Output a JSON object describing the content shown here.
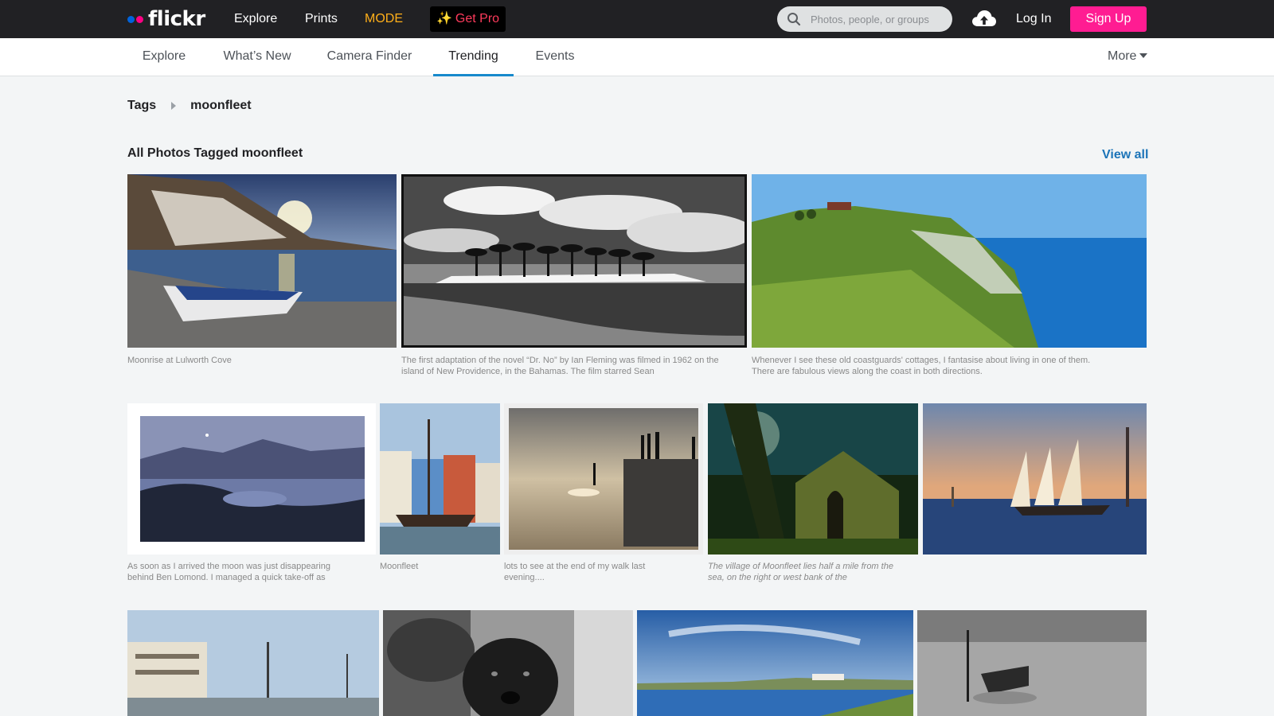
{
  "topbar": {
    "logo_text": "flickr",
    "nav": {
      "explore": "Explore",
      "prints": "Prints",
      "mode": "MODE"
    },
    "get_pro": "Get Pro",
    "search_placeholder": "Photos, people, or groups",
    "login": "Log In",
    "signup": "Sign Up"
  },
  "subnav": {
    "items": [
      "Explore",
      "What’s New",
      "Camera Finder",
      "Trending",
      "Events"
    ],
    "active": "Trending",
    "more": "More"
  },
  "breadcrumb": {
    "root": "Tags",
    "current": "moonfleet"
  },
  "section": {
    "title": "All Photos Tagged moonfleet",
    "view_all": "View all"
  },
  "photos": [
    {
      "caption": "Moonrise at Lulworth Cove"
    },
    {
      "caption": "The first adaptation of the novel “Dr. No” by Ian Fleming was filmed in 1962 on the island of New Providence, in the Bahamas. The film starred Sean"
    },
    {
      "caption": "Whenever I see these old coastguards' cottages, I fantasise about living in one of them. There are fabulous views along the coast in both directions."
    },
    {
      "caption": "As soon as I arrived the moon was just disappearing behind Ben Lomond. I managed a quick take-off as"
    },
    {
      "caption": "Moonfleet"
    },
    {
      "caption": "lots to see at the end of my walk last evening...."
    },
    {
      "caption": "The village of Moonfleet lies half a mile from the sea, on the right or west bank of the"
    },
    {
      "caption": ""
    }
  ],
  "colors": {
    "accent_blue": "#1789cc",
    "signup_pink": "#ff1c92",
    "mode_orange": "#ffaf19",
    "topbar_bg": "#212124"
  }
}
